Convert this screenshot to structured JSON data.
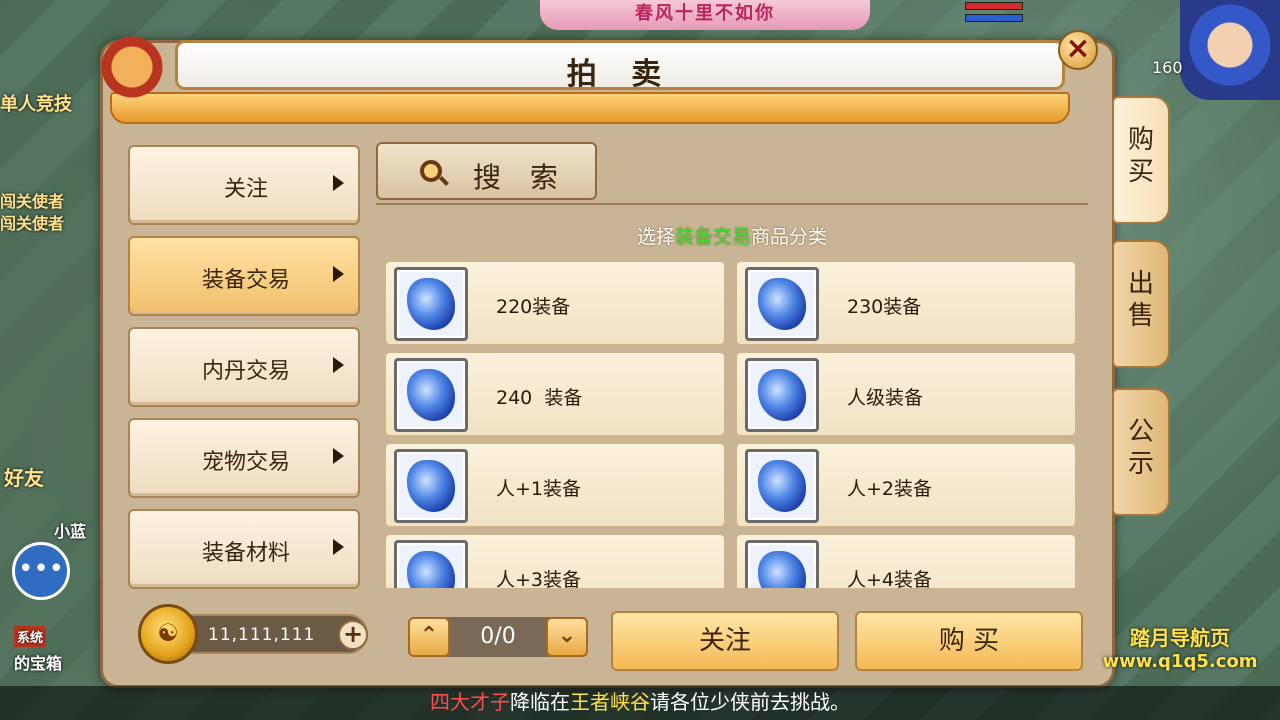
{
  "background": {
    "banner_text": "春风十里不如你",
    "level_text": "160",
    "side_labels": [
      "单人竞技",
      "闯关使者",
      "闯关使者",
      "好友",
      "小蓝",
      "系统",
      "的宝箱"
    ],
    "chat_icon": "chat-bubble-icon"
  },
  "title": "拍 卖",
  "close_icon": "close-x-icon",
  "categories": [
    {
      "label": "关注",
      "active": false
    },
    {
      "label": "装备交易",
      "active": true
    },
    {
      "label": "内丹交易",
      "active": false
    },
    {
      "label": "宠物交易",
      "active": false
    },
    {
      "label": "装备材料",
      "active": false
    }
  ],
  "search": {
    "label": "搜 索",
    "icon": "search-icon"
  },
  "hint": {
    "prefix": "选择",
    "highlight": "装备交易",
    "suffix": "商品分类"
  },
  "items": [
    {
      "name": "220装备"
    },
    {
      "name": "230装备"
    },
    {
      "name": "240  装备"
    },
    {
      "name": "人级装备"
    },
    {
      "name": "人+1装备"
    },
    {
      "name": "人+2装备"
    },
    {
      "name": "人+3装备"
    },
    {
      "name": "人+4装备"
    }
  ],
  "currency": {
    "value": "11,111,111",
    "icon": "gold-coin-icon",
    "add_label": "+"
  },
  "pager": {
    "text": "0/0",
    "up_icon": "chevron-up-icon",
    "down_icon": "chevron-down-icon"
  },
  "actions": {
    "follow_label": "关注",
    "buy_label": "购 买"
  },
  "side_tabs": [
    {
      "label": "购\n买",
      "active": true
    },
    {
      "label": "出\n售",
      "active": false
    },
    {
      "label": "公\n示",
      "active": false
    }
  ],
  "notice": {
    "part1": "四大才子",
    "part2": "降临在",
    "part3": "王者峡谷",
    "part4": "请各位少侠前去挑战。"
  },
  "watermark": {
    "title": "踏月导航页",
    "url": "www.q1q5.com"
  },
  "colors": {
    "highlight_green": "#35e12c",
    "notice_red": "#ff4c4c",
    "notice_yellow": "#ffe04a",
    "accent_gold": "#f3b955"
  }
}
